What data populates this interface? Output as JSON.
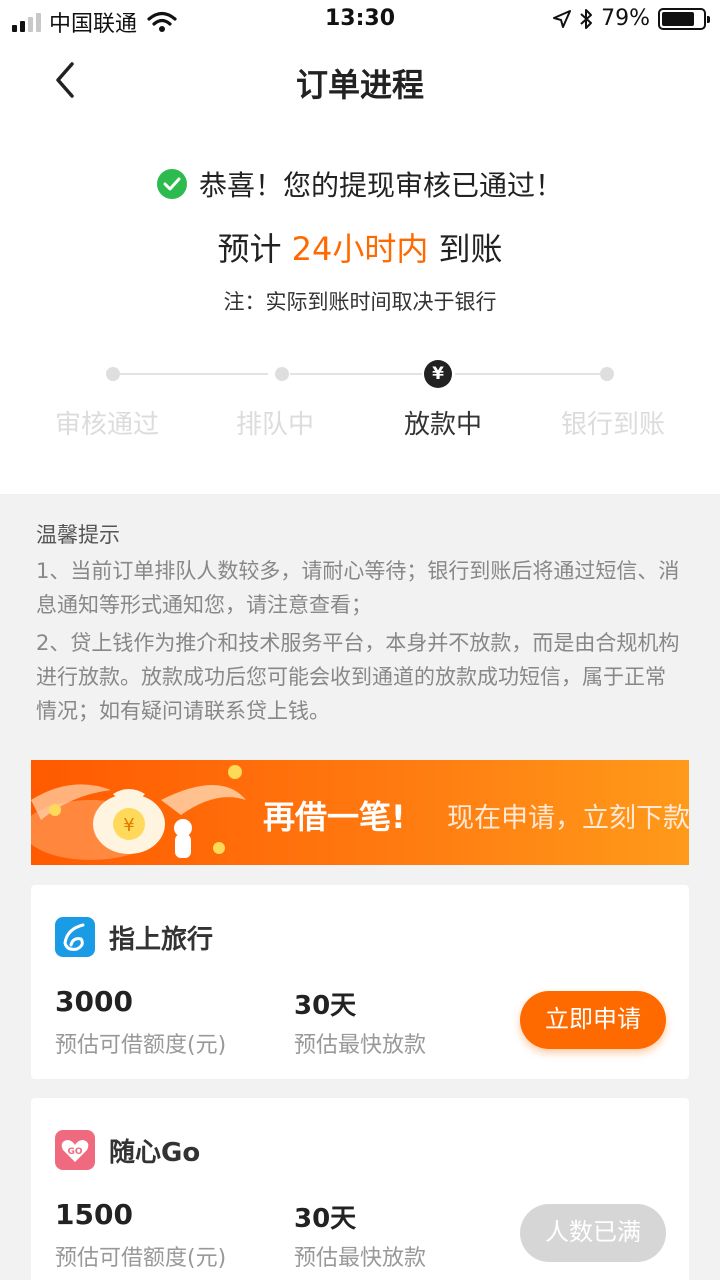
{
  "status_bar": {
    "carrier": "中国联通",
    "time": "13:30",
    "battery_percent": "79%",
    "battery_level": 0.79
  },
  "nav": {
    "title": "订单进程"
  },
  "result": {
    "congrats": "恭喜！您的提现审核已通过！",
    "eta_prefix": "预计 ",
    "eta_highlight": "24小时内",
    "eta_suffix": " 到账",
    "note": "注：实际到账时间取决于银行",
    "highlight_color": "#ff6a00"
  },
  "steps": [
    {
      "label": "审核通过",
      "active": false
    },
    {
      "label": "排队中",
      "active": false
    },
    {
      "label": "放款中",
      "active": true,
      "symbol": "¥"
    },
    {
      "label": "银行到账",
      "active": false
    }
  ],
  "tips": {
    "title": "温馨提示",
    "item1": "1、当前订单排队人数较多，请耐心等待；银行到账后将通过短信、消息通知等形式通知您，请注意查看；",
    "item2": "2、贷上钱作为推介和技术服务平台，本身并不放款，而是由合规机构进行放款。放款成功后您可能会收到通道的放款成功短信，属于正常情况；如有疑问请联系贷上钱。"
  },
  "banner": {
    "title": "再借一笔!",
    "subtitle": "现在申请，立刻下款",
    "coin_symbol": "¥"
  },
  "products": [
    {
      "name": "指上旅行",
      "amount": "3000",
      "amount_label": "预估可借额度(元)",
      "days": "30天",
      "days_label": "预估最快放款",
      "button": "立即申请",
      "button_state": "enabled",
      "logo_color": "#1a9be6"
    },
    {
      "name": "随心Go",
      "amount": "1500",
      "amount_label": "预估可借额度(元)",
      "days": "30天",
      "days_label": "预估最快放款",
      "button": "人数已满",
      "button_state": "disabled",
      "logo_color": "#f06a7f",
      "logo_text": "GO"
    }
  ]
}
